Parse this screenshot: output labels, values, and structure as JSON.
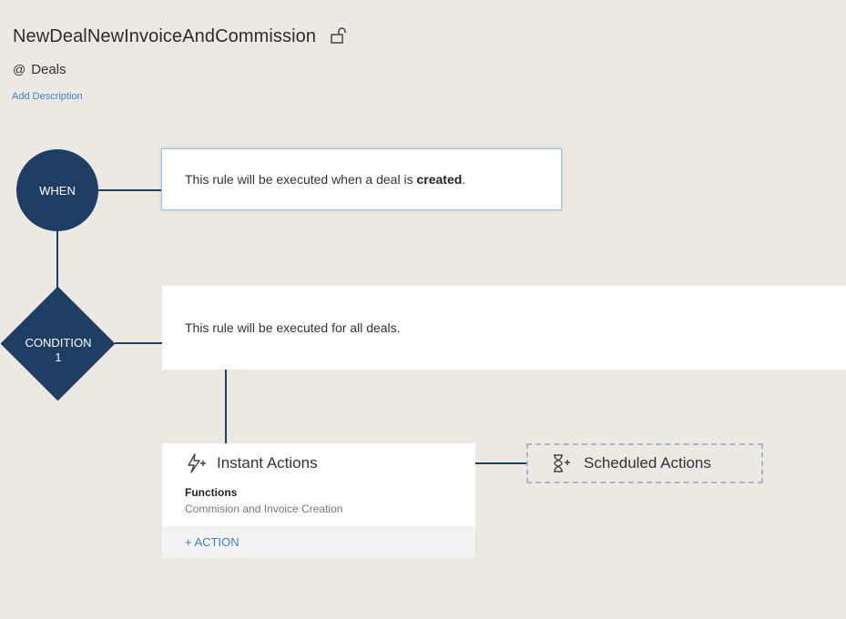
{
  "rule": {
    "name": "NewDealNewInvoiceAndCommission",
    "module_prefix": "@",
    "module": "Deals",
    "add_description": "Add Description"
  },
  "when": {
    "label": "WHEN",
    "text_before": "This rule will be executed when a deal is ",
    "text_bold": "created",
    "text_after": "."
  },
  "condition": {
    "label_line1": "CONDITION",
    "label_line2": "1",
    "text": "This rule will be executed for all deals."
  },
  "instant_actions": {
    "title": "Instant Actions",
    "function_label": "Functions",
    "function_value": "Commision and Invoice Creation",
    "add_action": "+ ACTION"
  },
  "scheduled_actions": {
    "title": "Scheduled Actions"
  },
  "icons": {
    "lock": "unlock-icon",
    "instant": "bolt-plus-icon",
    "scheduled": "hourglass-plus-icon"
  },
  "colors": {
    "background": "#ece9e2",
    "node": "#1e3e63",
    "link": "#3c7fd4",
    "dashed_border": "#a9b6c4"
  }
}
